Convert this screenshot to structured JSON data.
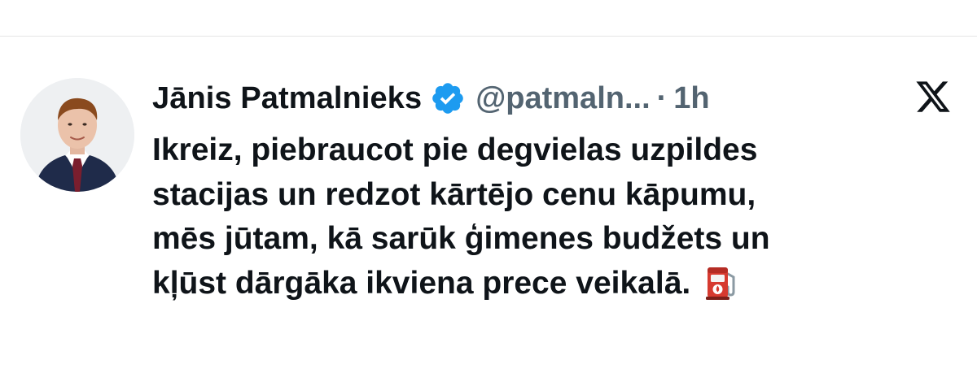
{
  "tweet": {
    "author_name": "Jānis Patmalnieks",
    "handle": "@patmaln...",
    "separator": "·",
    "time": "1h",
    "text_lines": [
      "Ikreiz, piebraucot pie degvielas uzpildes",
      "stacijas un redzot kārtējo cenu kāpumu,",
      "mēs jūtam, kā sarūk ģimenes budžets un",
      "kļūst dārgāka ikviena prece veikalā."
    ],
    "emoji": "fuel-pump-icon",
    "verified_badge": "verified-badge-icon",
    "platform_logo": "x-logo-icon"
  },
  "colors": {
    "text": "#0f1419",
    "secondary_text": "#536471",
    "verified_blue": "#1d9bf0",
    "fuel_pump_red": "#d63a30"
  }
}
